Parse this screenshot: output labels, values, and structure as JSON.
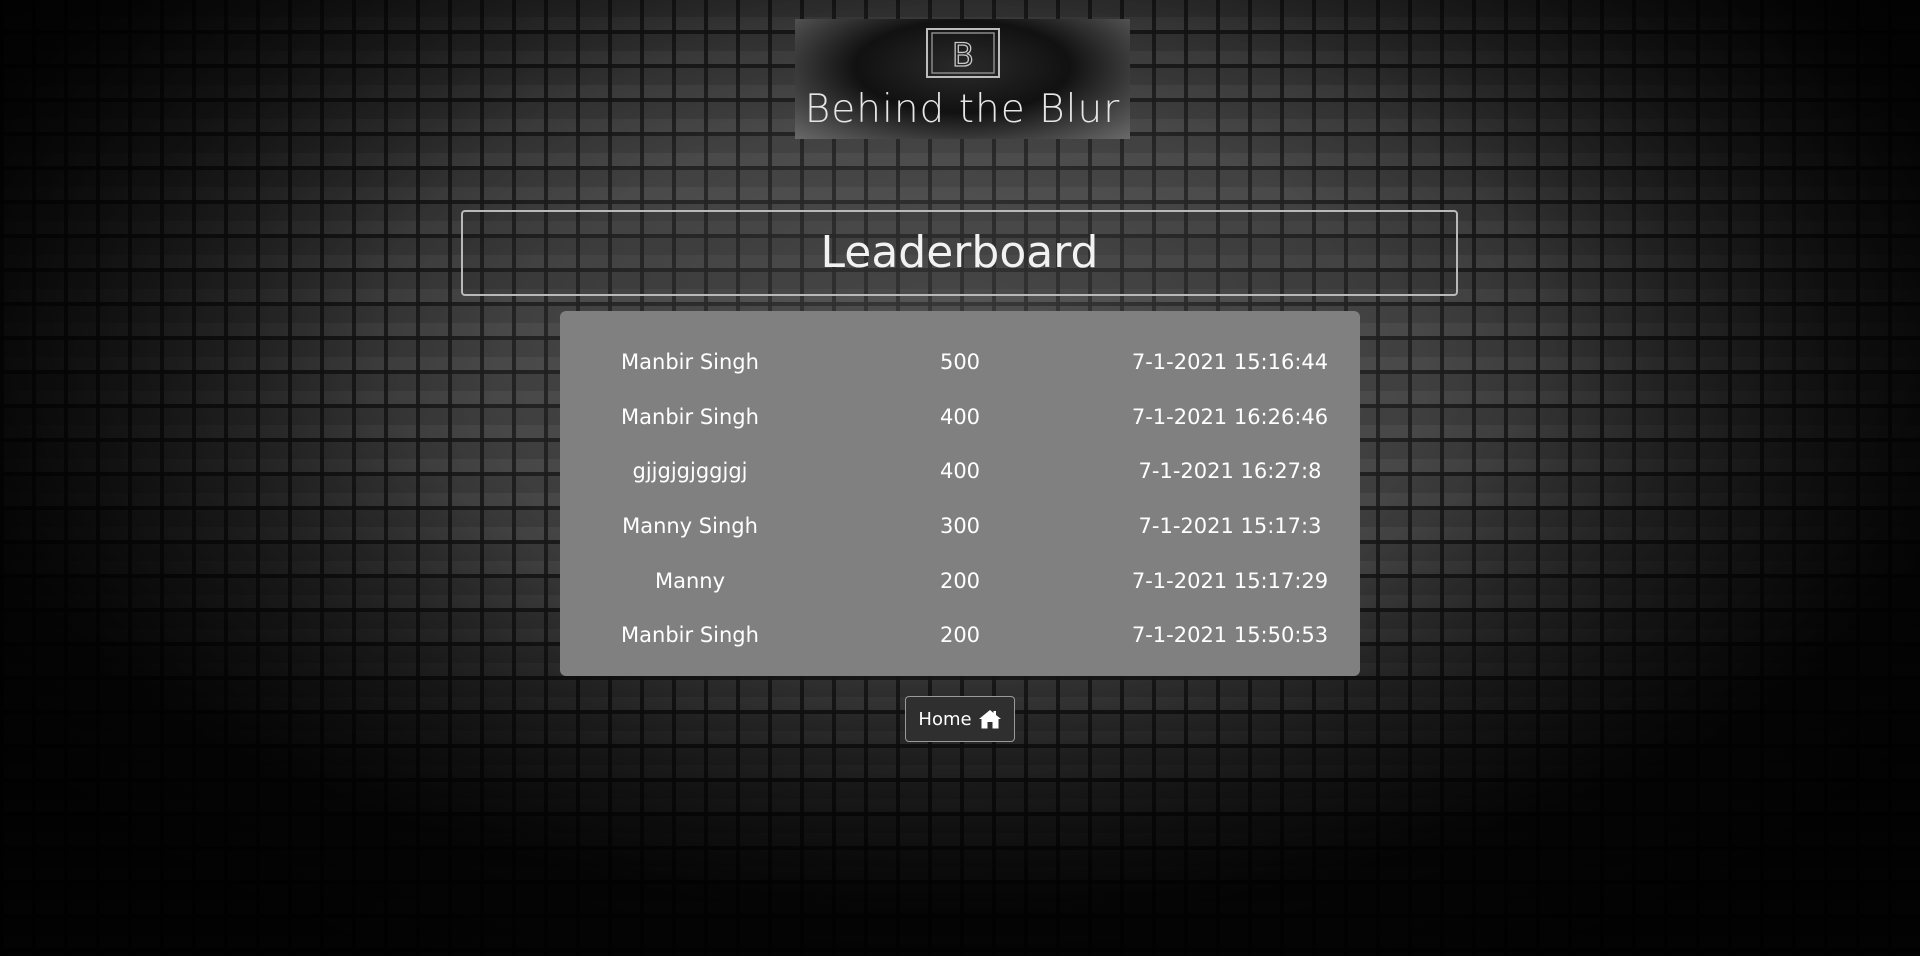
{
  "logo": {
    "letter": "B",
    "text": "Behind the Blur"
  },
  "page": {
    "title": "Leaderboard"
  },
  "leaderboard": {
    "rows": [
      {
        "name": "Manbir Singh",
        "score": "500",
        "time": "7-1-2021 15:16:44"
      },
      {
        "name": "Manbir Singh",
        "score": "400",
        "time": "7-1-2021 16:26:46"
      },
      {
        "name": "gjjgjgjggjgj",
        "score": "400",
        "time": "7-1-2021 16:27:8"
      },
      {
        "name": "Manny Singh",
        "score": "300",
        "time": "7-1-2021 15:17:3"
      },
      {
        "name": "Manny",
        "score": "200",
        "time": "7-1-2021 15:17:29"
      },
      {
        "name": "Manbir Singh",
        "score": "200",
        "time": "7-1-2021 15:50:53"
      }
    ]
  },
  "home_button": {
    "label": "Home",
    "icon": "home-icon"
  },
  "colors": {
    "board_bg": "#808080",
    "button_bg": "#2f2f2f",
    "text": "#ffffff"
  }
}
